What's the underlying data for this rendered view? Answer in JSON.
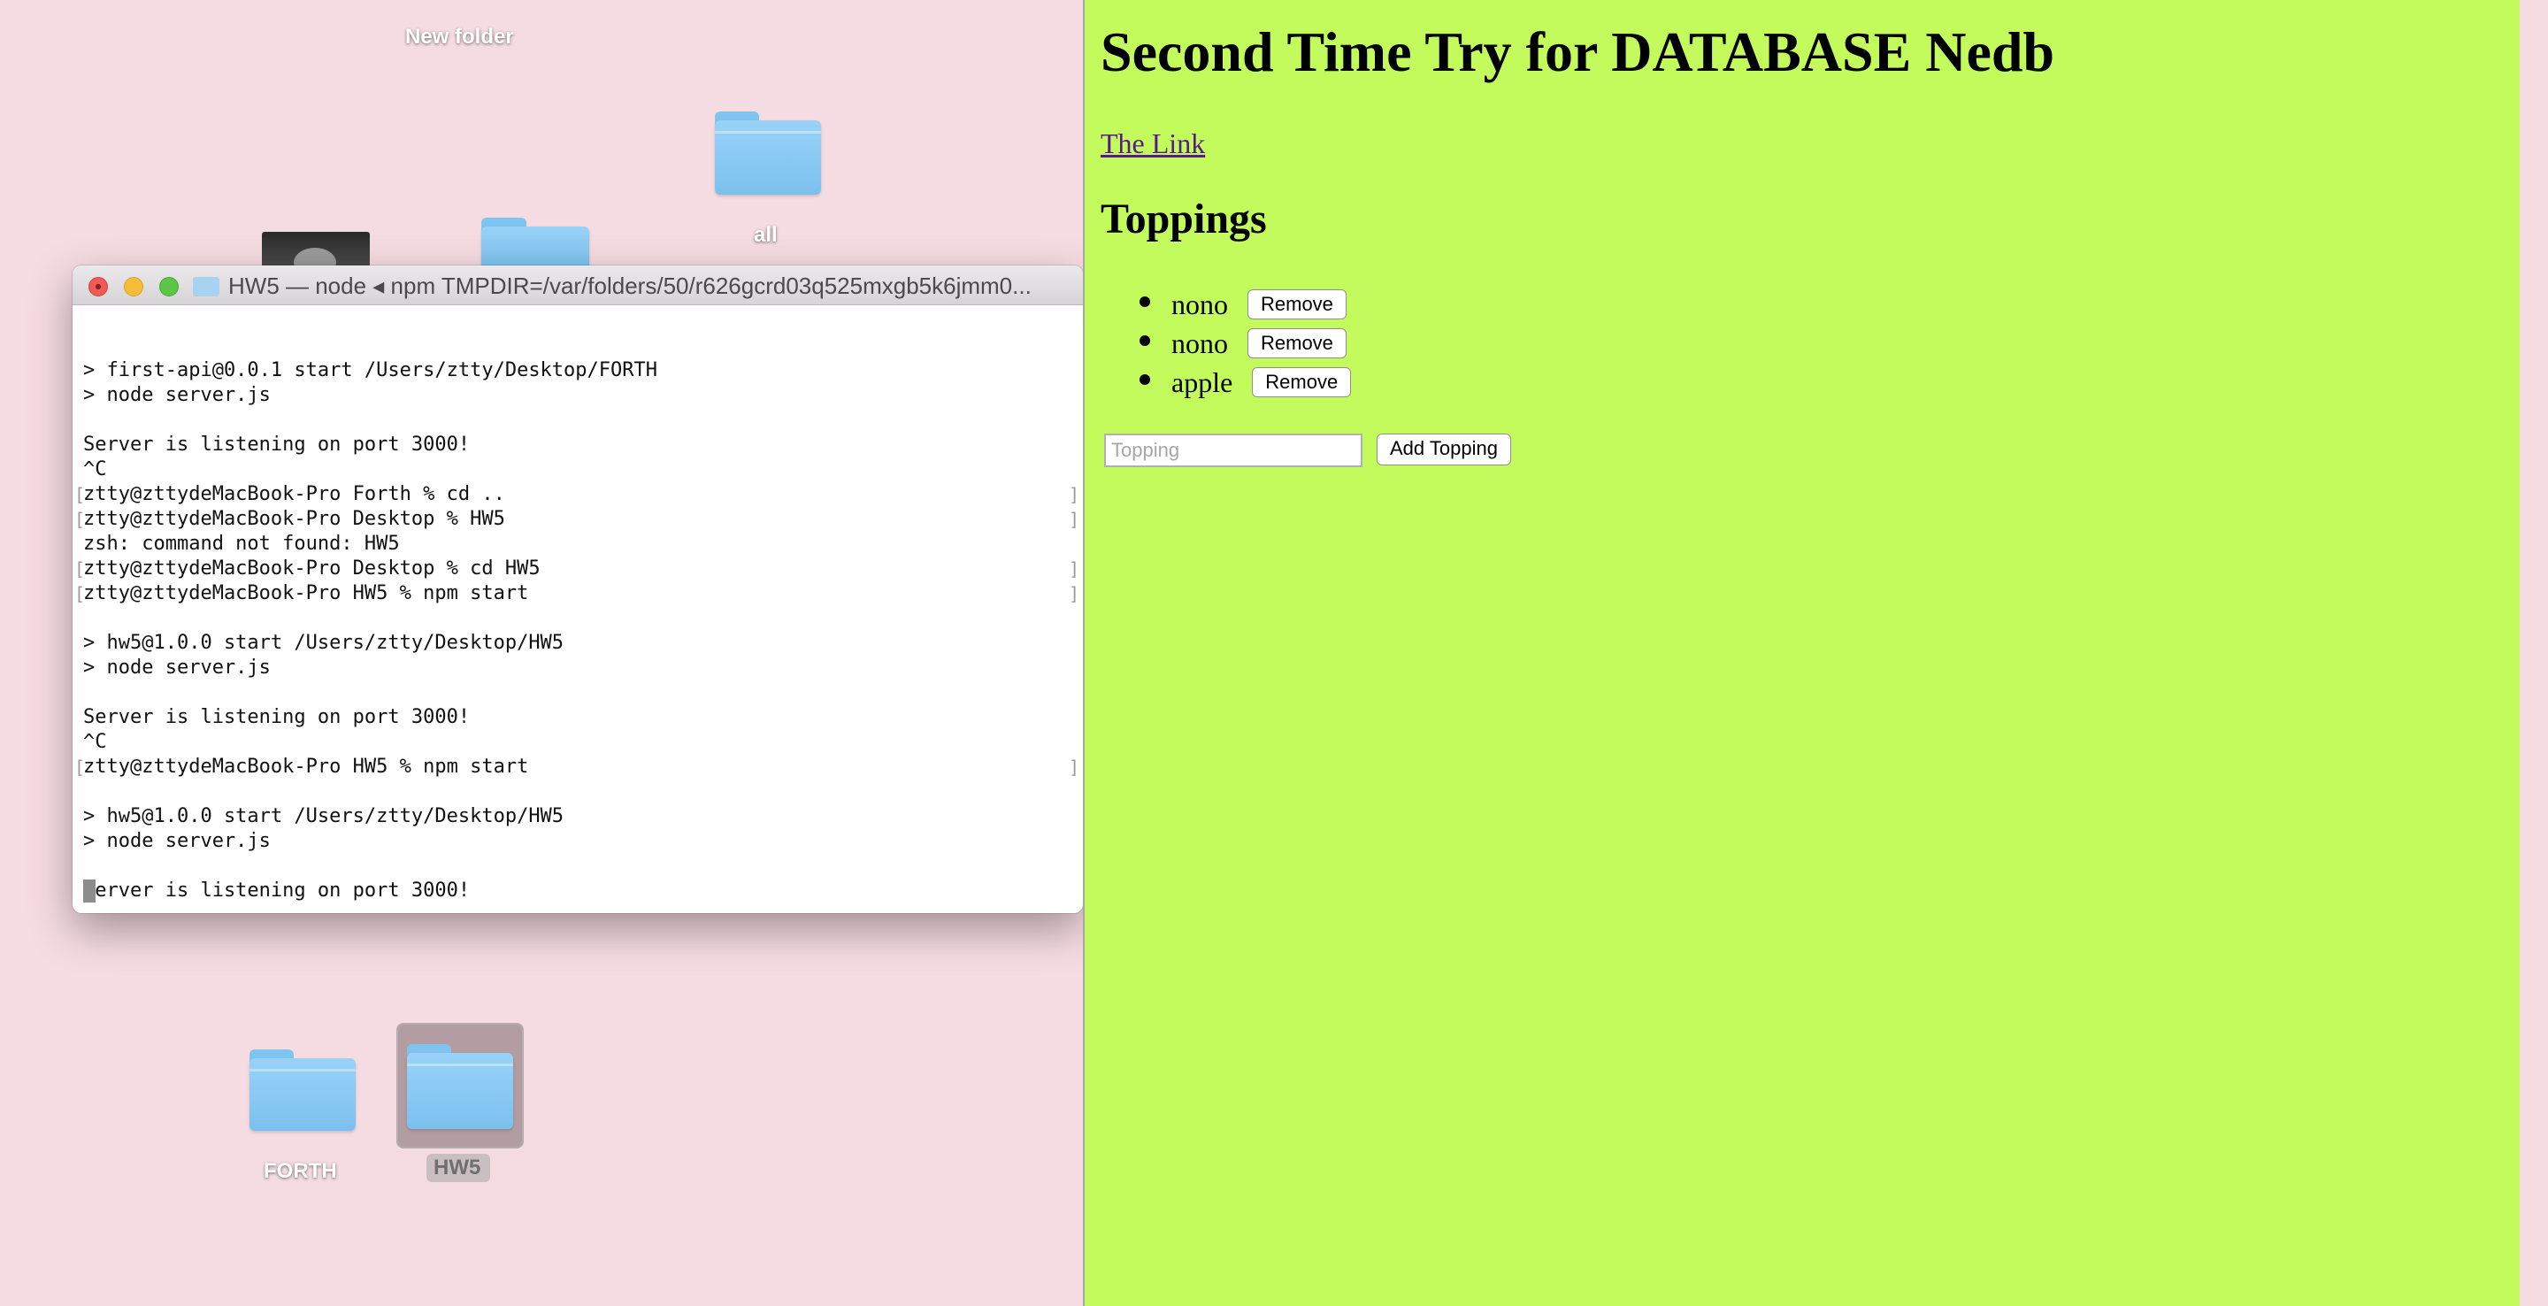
{
  "desktop": {
    "background_color": "#f5dce2",
    "icons": {
      "new_folder_label": "New folder",
      "all_label": "all",
      "forth_label": "FORTH",
      "hw5_label": "HW5"
    }
  },
  "terminal": {
    "title": "HW5 — node ◂ npm TMPDIR=/var/folders/50/r626gcrd03q525mxgb5k6jmm0...",
    "lines": [
      "",
      "> first-api@0.0.1 start /Users/ztty/Desktop/FORTH",
      "> node server.js",
      "",
      "Server is listening on port 3000!",
      "^C",
      "ztty@zttydeMacBook-Pro Forth % cd ..",
      "ztty@zttydeMacBook-Pro Desktop % HW5",
      "zsh: command not found: HW5",
      "ztty@zttydeMacBook-Pro Desktop % cd HW5",
      "ztty@zttydeMacBook-Pro HW5 % npm start",
      "",
      "> hw5@1.0.0 start /Users/ztty/Desktop/HW5",
      "> node server.js",
      "",
      "Server is listening on port 3000!",
      "^C",
      "ztty@zttydeMacBook-Pro HW5 % npm start",
      "",
      "> hw5@1.0.0 start /Users/ztty/Desktop/HW5",
      "> node server.js",
      "",
      "Server is listening on port 3000!"
    ]
  },
  "page": {
    "background_color": "#c3fb5c",
    "heading": "Second Time Try for DATABASE Nedb",
    "link_text": "The Link",
    "toppings_heading": "Toppings",
    "toppings": [
      {
        "name": "nono",
        "remove_label": "Remove"
      },
      {
        "name": "nono",
        "remove_label": "Remove"
      },
      {
        "name": "apple",
        "remove_label": "Remove"
      }
    ],
    "input_placeholder": "Topping",
    "add_button_label": "Add Topping"
  }
}
